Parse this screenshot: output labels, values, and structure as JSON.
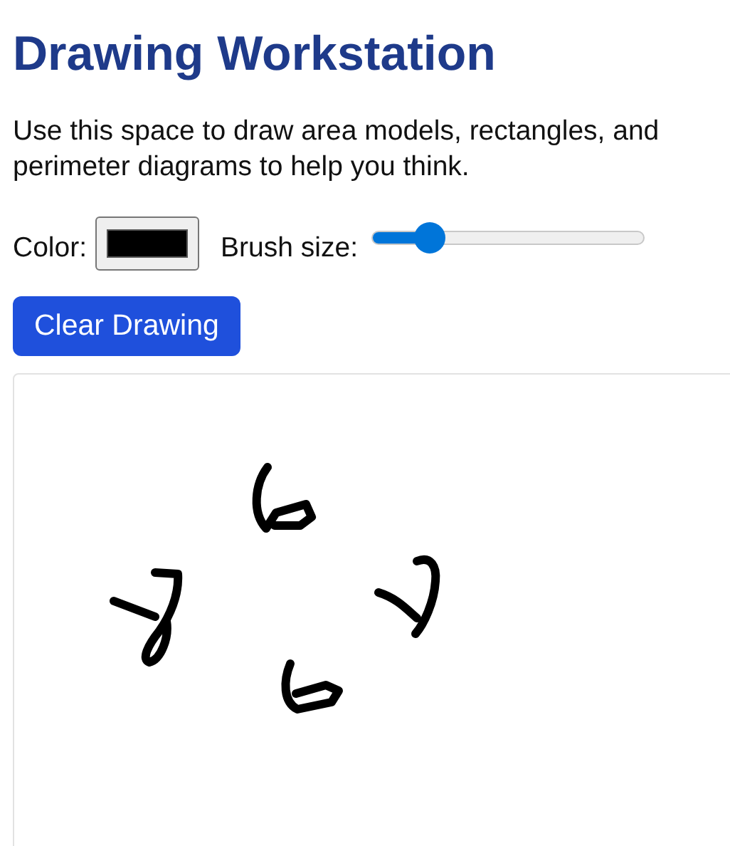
{
  "title": "Drawing Workstation",
  "intro": "Use this space to draw area models, rectangles, and perimeter diagrams to help you think.",
  "color_picker": {
    "label": "Color:",
    "color": "#000000"
  },
  "brush_size": {
    "label": "Brush size:",
    "level": 0.17
  },
  "clear_button": "Clear Drawing"
}
